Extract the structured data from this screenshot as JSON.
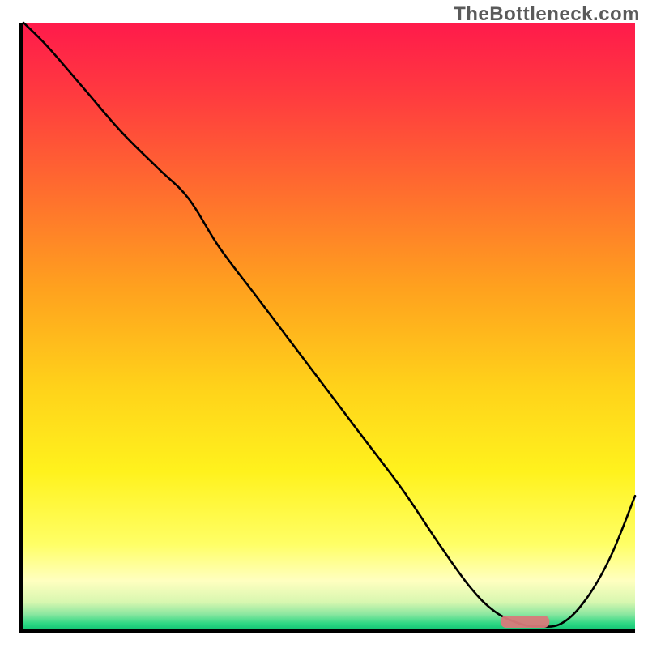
{
  "watermark": "TheBottleneck.com",
  "colors": {
    "axis": "#000000",
    "curve": "#000000",
    "marker": "#d87a7a",
    "gradient_stops": [
      {
        "offset": 0.0,
        "color": "#ff1a4b"
      },
      {
        "offset": 0.12,
        "color": "#ff3b3f"
      },
      {
        "offset": 0.28,
        "color": "#ff6e2e"
      },
      {
        "offset": 0.44,
        "color": "#ffa21e"
      },
      {
        "offset": 0.6,
        "color": "#ffd21a"
      },
      {
        "offset": 0.74,
        "color": "#fff21d"
      },
      {
        "offset": 0.86,
        "color": "#ffff66"
      },
      {
        "offset": 0.92,
        "color": "#ffffc0"
      },
      {
        "offset": 0.955,
        "color": "#d8f7b0"
      },
      {
        "offset": 0.975,
        "color": "#8be7a0"
      },
      {
        "offset": 0.99,
        "color": "#2fd884"
      },
      {
        "offset": 1.0,
        "color": "#12c574"
      }
    ]
  },
  "chart_data": {
    "type": "line",
    "title": "",
    "xlabel": "",
    "ylabel": "",
    "xlim": [
      0,
      100
    ],
    "ylim": [
      0,
      100
    ],
    "grid": false,
    "legend": false,
    "x": [
      0,
      4,
      10,
      16,
      22,
      27,
      32,
      38,
      44,
      50,
      56,
      62,
      68,
      73,
      77,
      81,
      84,
      88,
      92,
      96,
      100
    ],
    "values": [
      100,
      96,
      89,
      82,
      76,
      71,
      63,
      55,
      47,
      39,
      31,
      23,
      14,
      7,
      3,
      1,
      0.5,
      1,
      5,
      12,
      22
    ],
    "optimal_range_x": [
      78,
      86
    ],
    "annotations": []
  }
}
